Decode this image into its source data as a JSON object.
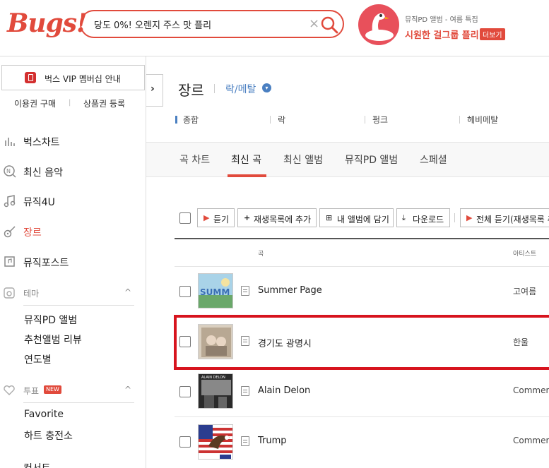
{
  "header": {
    "logo": "Bugs!",
    "search_value": "당도 0%! 오렌지 주스 맛 플리",
    "clear_glyph": "×",
    "promo_small": "뮤직PD 앨범 - 여름 특집",
    "promo_title": "시원한 걸그룹 플리",
    "promo_badge": "더보기"
  },
  "sidebar": {
    "vip_label": "벅스 VIP 멤버십 안내",
    "buy_label": "이용권 구매",
    "gift_label": "상품권 등록",
    "collapse_glyph": "›",
    "nav": [
      {
        "label": "벅스차트"
      },
      {
        "label": "최신 음악"
      },
      {
        "label": "뮤직4U"
      },
      {
        "label": "장르"
      },
      {
        "label": "뮤직포스트"
      }
    ],
    "theme_header": "테마",
    "theme_items": [
      "뮤직PD 앨범",
      "추천앨범 리뷰",
      "연도별"
    ],
    "vote_header": "투표",
    "vote_new": "NEW",
    "vote_items": [
      "Favorite",
      "하트 충전소"
    ],
    "concert_label": "컨서트",
    "chevron_up": "^"
  },
  "main": {
    "title": "장르",
    "sub_genre": "락/메탈",
    "genre_tabs": [
      "종합",
      "락",
      "펑크",
      "헤비메탈"
    ],
    "tabs": [
      "곡 차트",
      "최신 곡",
      "최신 앨범",
      "뮤직PD 앨범",
      "스페셜"
    ],
    "active_tab": "최신 곡",
    "toolbar": {
      "listen": "듣기",
      "add_playlist": "재생목록에 추가",
      "add_album": "내 앨범에 담기",
      "download": "다운로드",
      "listen_all": "전체 듣기(재생목록 추가)"
    },
    "columns": {
      "title": "곡",
      "artist": "아티스트"
    },
    "tracks": [
      {
        "title": "Summer Page",
        "artist": "고여름"
      },
      {
        "title": "경기도 광명시",
        "artist": "한울"
      },
      {
        "title": "Alain Delon",
        "artist": "Commentary"
      },
      {
        "title": "Trump",
        "artist": "Commentary"
      }
    ]
  },
  "colors": {
    "brand": "#e14a3c",
    "highlight": "#d7141e",
    "link": "#4a7fc1"
  }
}
